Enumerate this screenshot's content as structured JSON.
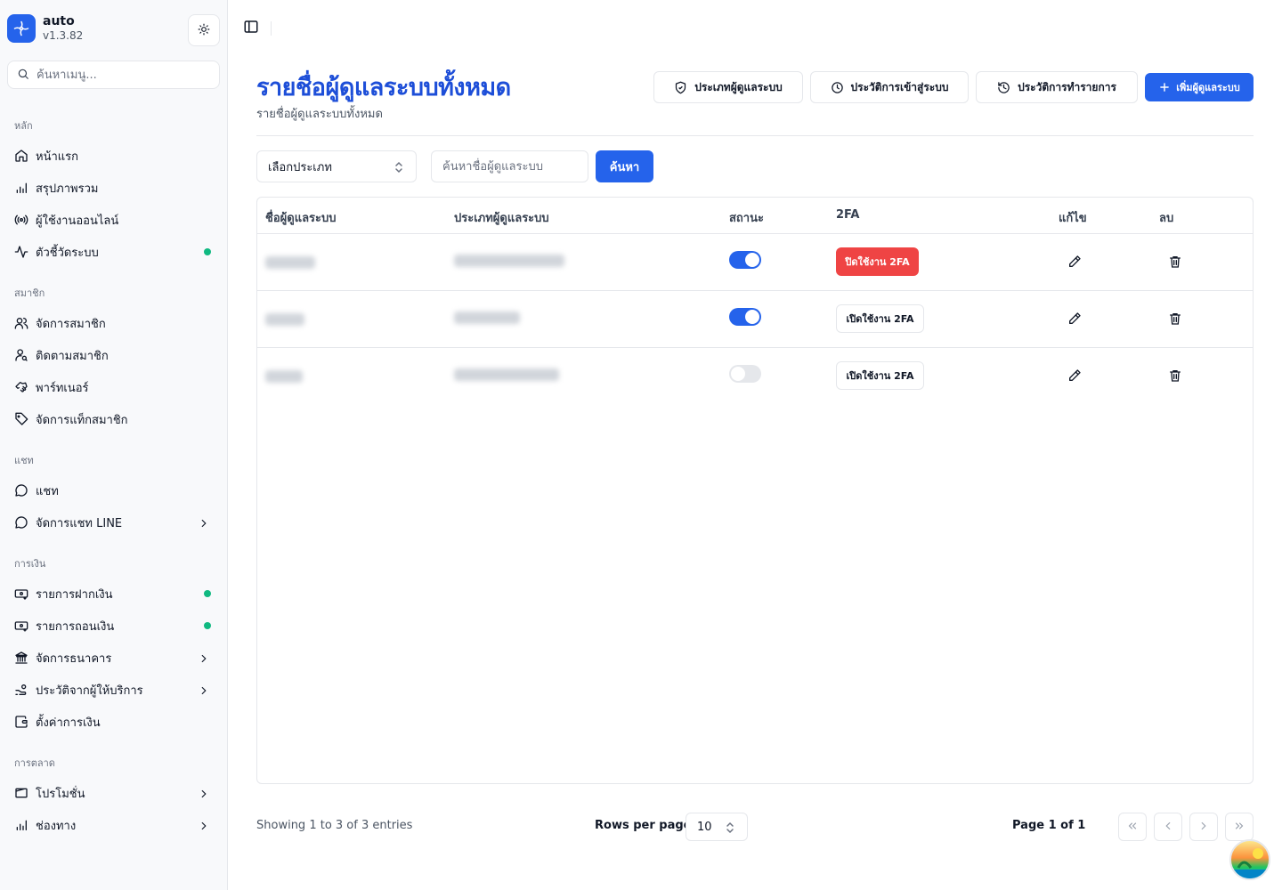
{
  "brand": {
    "name": "auto",
    "version": "v1.3.82"
  },
  "sidebar": {
    "search_placeholder": "ค้นหาเมนู...",
    "groups": [
      {
        "label": "หลัก",
        "items": [
          {
            "label": "หน้าแรก",
            "icon": "home-icon"
          },
          {
            "label": "สรุปภาพรวม",
            "icon": "bar-chart-icon"
          },
          {
            "label": "ผู้ใช้งานออนไลน์",
            "icon": "broadcast-icon"
          },
          {
            "label": "ตัวชี้วัดระบบ",
            "icon": "activity-icon",
            "status_dot": true
          }
        ]
      },
      {
        "label": "สมาชิก",
        "items": [
          {
            "label": "จัดการสมาชิก",
            "icon": "users-icon"
          },
          {
            "label": "ติดตามสมาชิก",
            "icon": "user-search-icon"
          },
          {
            "label": "พาร์ทเนอร์",
            "icon": "handshake-icon"
          },
          {
            "label": "จัดการแท็กสมาชิก",
            "icon": "tag-icon"
          }
        ]
      },
      {
        "label": "แชท",
        "items": [
          {
            "label": "แชท",
            "icon": "chat-icon"
          },
          {
            "label": "จัดการแชท LINE",
            "icon": "chat-icon",
            "has_children": true
          }
        ]
      },
      {
        "label": "การเงิน",
        "items": [
          {
            "label": "รายการฝากเงิน",
            "icon": "deposit-icon",
            "status_dot": true
          },
          {
            "label": "รายการถอนเงิน",
            "icon": "withdraw-icon",
            "status_dot": true
          },
          {
            "label": "จัดการธนาคาร",
            "icon": "bank-icon",
            "has_children": true
          },
          {
            "label": "ประวัติจากผู้ให้บริการ",
            "icon": "hand-coins-icon",
            "has_children": true
          },
          {
            "label": "ตั้งค่าการเงิน",
            "icon": "wallet-icon"
          }
        ]
      },
      {
        "label": "การตลาด",
        "items": [
          {
            "label": "โปรโมชั่น",
            "icon": "ticket-icon",
            "has_children": true
          },
          {
            "label": "ช่องทาง",
            "icon": "bar-chart-icon",
            "has_children": true
          }
        ]
      }
    ]
  },
  "header": {
    "title": "รายชื่อผู้ดูแลระบบทั้งหมด",
    "subtitle": "รายชื่อผู้ดูแลระบบทั้งหมด",
    "buttons": {
      "admin_types": "ประเภทผู้ดูแลระบบ",
      "login_history": "ประวัติการเข้าสู่ระบบ",
      "transaction_history": "ประวัติการทำรายการ",
      "add_admin": "เพิ่มผู้ดูแลระบบ"
    }
  },
  "filters": {
    "type_select": "เลือกประเภท",
    "search_placeholder": "ค้นหาชื่อผู้ดูแลระบบ",
    "search_button": "ค้นหา"
  },
  "table": {
    "columns": [
      "ชื่อผู้ดูแลระบบ",
      "ประเภทผู้ดูแลระบบ",
      "สถานะ",
      "2FA",
      "แก้ไข",
      "ลบ"
    ],
    "rows": [
      {
        "status_on": true,
        "twofa_label": "ปิดใช้งาน 2FA",
        "twofa_enabled": true
      },
      {
        "status_on": true,
        "twofa_label": "เปิดใช้งาน 2FA",
        "twofa_enabled": false
      },
      {
        "status_on": false,
        "twofa_label": "เปิดใช้งาน 2FA",
        "twofa_enabled": false
      }
    ]
  },
  "footer": {
    "showing": "Showing 1 to 3 of 3 entries",
    "rows_per_page_label": "Rows per page",
    "rows_per_page_value": "10",
    "page_info": "Page 1 of 1"
  },
  "colors": {
    "primary": "#2563eb",
    "title": "#1d4ed8",
    "danger": "#ef4444",
    "online": "#10b981"
  }
}
